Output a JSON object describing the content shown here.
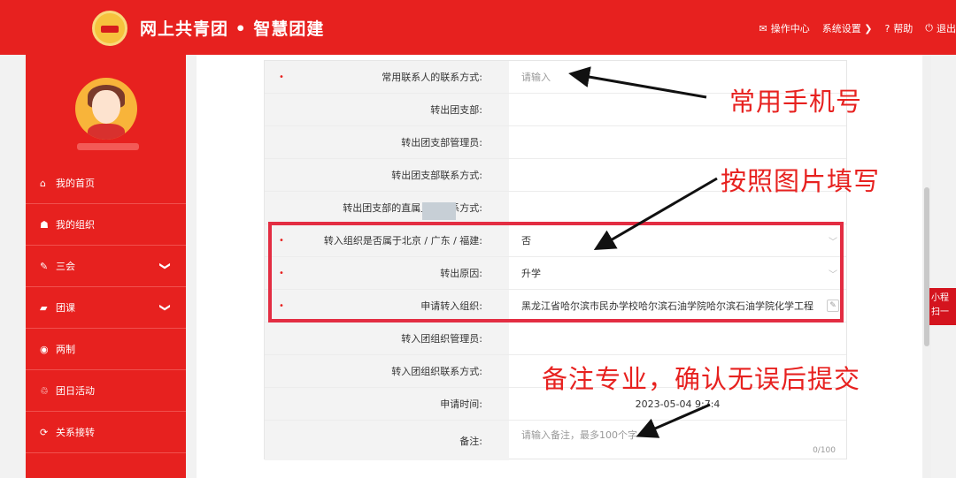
{
  "header": {
    "brand": "网上共青团 • 智慧团建",
    "nav": [
      {
        "icon": "mail-icon",
        "glyph": "✉",
        "label": "操作中心"
      },
      {
        "icon": "chevron-down-icon",
        "glyph": "",
        "label": "系统设置 ❯"
      },
      {
        "icon": "help-icon",
        "glyph": "?",
        "label": "帮助"
      },
      {
        "icon": "power-icon",
        "glyph": "⏻",
        "label": "退出"
      }
    ]
  },
  "sidebar": {
    "items": [
      {
        "icon": "home-icon",
        "glyph": "⌂",
        "label": "我的首页",
        "chevron": ""
      },
      {
        "icon": "users-icon",
        "glyph": "☗",
        "label": "我的组织",
        "chevron": ""
      },
      {
        "icon": "edit-icon",
        "glyph": "✎",
        "label": "三会",
        "chevron": "❯"
      },
      {
        "icon": "folder-icon",
        "glyph": "▰",
        "label": "团课",
        "chevron": "❯"
      },
      {
        "icon": "target-icon",
        "glyph": "◉",
        "label": "两制",
        "chevron": ""
      },
      {
        "icon": "recycle-icon",
        "glyph": "♲",
        "label": "团日活动",
        "chevron": ""
      },
      {
        "icon": "refresh-icon",
        "glyph": "⟳",
        "label": "关系接转",
        "chevron": ""
      }
    ]
  },
  "form": {
    "rows": [
      {
        "label": "常用联系人的联系方式:",
        "value": "",
        "placeholder": "请输入",
        "required": "•"
      },
      {
        "label": "转出团支部:",
        "value": "",
        "placeholder": "",
        "required": ""
      },
      {
        "label": "转出团支部管理员:",
        "value": "",
        "placeholder": "",
        "required": ""
      },
      {
        "label": "转出团支部联系方式:",
        "value": "",
        "placeholder": "",
        "required": ""
      },
      {
        "label": "转出团支部的直属上级联系方式:",
        "value": "",
        "placeholder": "",
        "required": ""
      },
      {
        "label": "转入组织是否属于北京 / 广东 / 福建:",
        "value": "否",
        "placeholder": "",
        "required": "•"
      },
      {
        "label": "转出原因:",
        "value": "升学",
        "placeholder": "",
        "required": "•"
      },
      {
        "label": "申请转入组织:",
        "value": "黑龙江省哈尔滨市民办学校哈尔滨石油学院哈尔滨石油学院化学工程",
        "placeholder": "",
        "required": "•"
      },
      {
        "label": "转入团组织管理员:",
        "value": "",
        "placeholder": "",
        "required": ""
      },
      {
        "label": "转入团组织联系方式:",
        "value": "",
        "placeholder": "",
        "required": ""
      },
      {
        "label": "申请时间:",
        "value": "2023-05-04 9:7:4",
        "placeholder": "",
        "required": ""
      },
      {
        "label": "备注:",
        "value": "",
        "placeholder": "请输入备注，最多100个字",
        "required": ""
      }
    ],
    "remark_counter": "0/100",
    "select_arrow": "﹀",
    "clip_glyph": "✎"
  },
  "annotations": {
    "phone": "常用手机号",
    "fill": "按照图片填写",
    "remark": "备注专业，确认无误后提交"
  },
  "right_badge": {
    "line1": "小程",
    "line2": "扫一"
  }
}
